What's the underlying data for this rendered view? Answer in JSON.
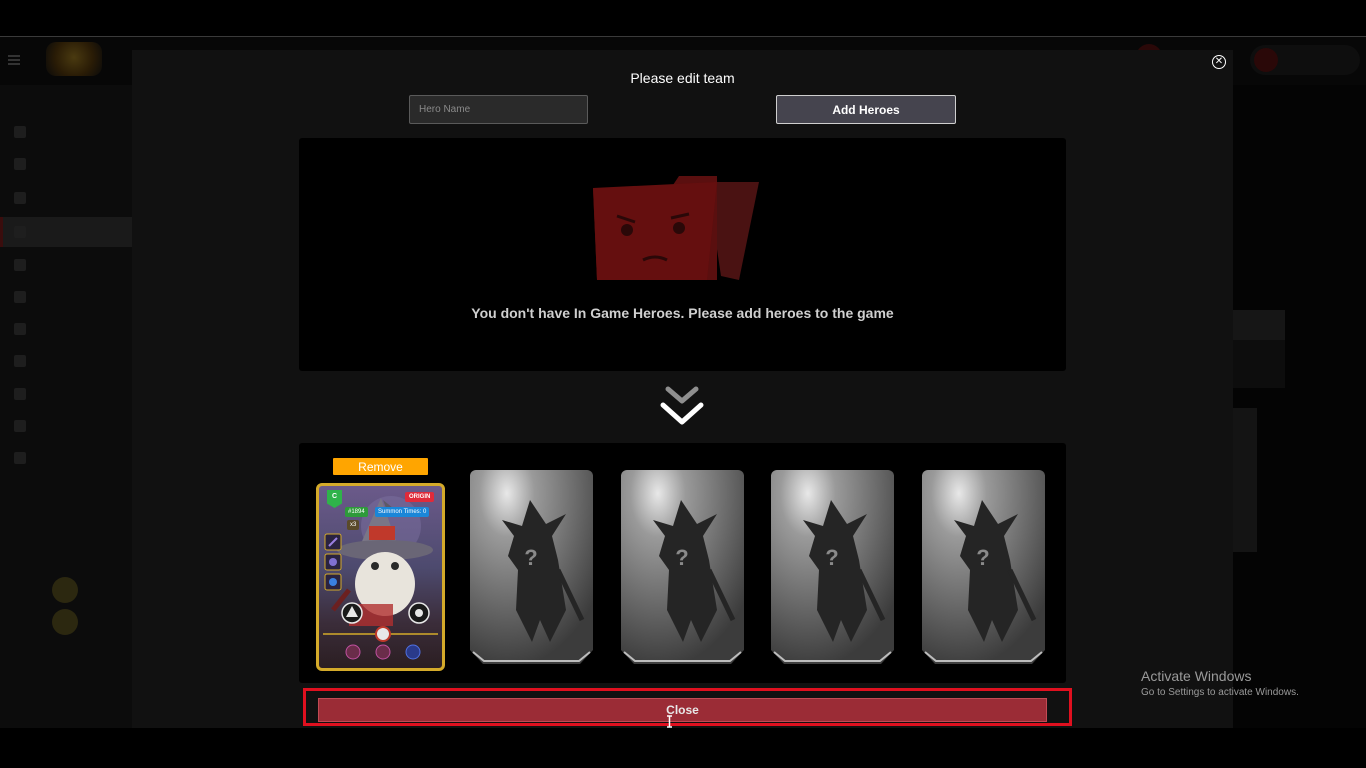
{
  "modal": {
    "title": "Please edit team",
    "close_icon": "close-icon",
    "search": {
      "placeholder": "Hero Name",
      "value": ""
    },
    "add_button_label": "Add Heroes",
    "empty_message": "You don't have In Game Heroes. Please add heroes to the game",
    "remove_label": "Remove",
    "hero_card": {
      "rarity": "C",
      "tag": "ORIGIN",
      "id": "#1894",
      "summon_times": "Summon Times: 0",
      "multiplier": "x3"
    },
    "close_button_label": "Close",
    "empty_slot_icon": "question-mark-silhouette-icon"
  },
  "watermark": {
    "title": "Activate Windows",
    "subtitle": "Go to Settings to activate Windows."
  },
  "colors": {
    "remove": "#ffa500",
    "close_bar": "#9b2c36",
    "highlight": "#e0101f",
    "card_border": "#d4aa2a",
    "origin_badge": "#e02a3a"
  }
}
